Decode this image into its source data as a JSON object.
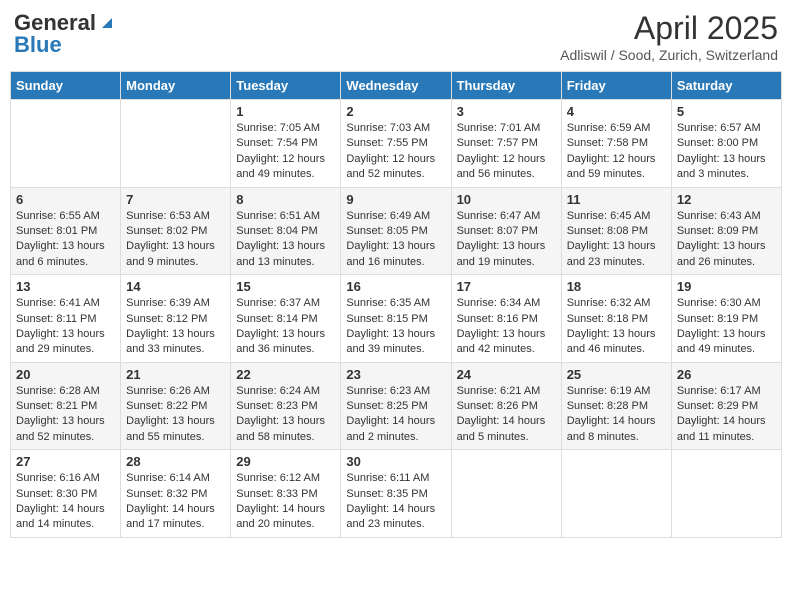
{
  "header": {
    "logo_general": "General",
    "logo_blue": "Blue",
    "title": "April 2025",
    "subtitle": "Adliswil / Sood, Zurich, Switzerland"
  },
  "days_of_week": [
    "Sunday",
    "Monday",
    "Tuesday",
    "Wednesday",
    "Thursday",
    "Friday",
    "Saturday"
  ],
  "weeks": [
    [
      {
        "day": "",
        "sunrise": "",
        "sunset": "",
        "daylight": ""
      },
      {
        "day": "",
        "sunrise": "",
        "sunset": "",
        "daylight": ""
      },
      {
        "day": "1",
        "sunrise": "Sunrise: 7:05 AM",
        "sunset": "Sunset: 7:54 PM",
        "daylight": "Daylight: 12 hours and 49 minutes."
      },
      {
        "day": "2",
        "sunrise": "Sunrise: 7:03 AM",
        "sunset": "Sunset: 7:55 PM",
        "daylight": "Daylight: 12 hours and 52 minutes."
      },
      {
        "day": "3",
        "sunrise": "Sunrise: 7:01 AM",
        "sunset": "Sunset: 7:57 PM",
        "daylight": "Daylight: 12 hours and 56 minutes."
      },
      {
        "day": "4",
        "sunrise": "Sunrise: 6:59 AM",
        "sunset": "Sunset: 7:58 PM",
        "daylight": "Daylight: 12 hours and 59 minutes."
      },
      {
        "day": "5",
        "sunrise": "Sunrise: 6:57 AM",
        "sunset": "Sunset: 8:00 PM",
        "daylight": "Daylight: 13 hours and 3 minutes."
      }
    ],
    [
      {
        "day": "6",
        "sunrise": "Sunrise: 6:55 AM",
        "sunset": "Sunset: 8:01 PM",
        "daylight": "Daylight: 13 hours and 6 minutes."
      },
      {
        "day": "7",
        "sunrise": "Sunrise: 6:53 AM",
        "sunset": "Sunset: 8:02 PM",
        "daylight": "Daylight: 13 hours and 9 minutes."
      },
      {
        "day": "8",
        "sunrise": "Sunrise: 6:51 AM",
        "sunset": "Sunset: 8:04 PM",
        "daylight": "Daylight: 13 hours and 13 minutes."
      },
      {
        "day": "9",
        "sunrise": "Sunrise: 6:49 AM",
        "sunset": "Sunset: 8:05 PM",
        "daylight": "Daylight: 13 hours and 16 minutes."
      },
      {
        "day": "10",
        "sunrise": "Sunrise: 6:47 AM",
        "sunset": "Sunset: 8:07 PM",
        "daylight": "Daylight: 13 hours and 19 minutes."
      },
      {
        "day": "11",
        "sunrise": "Sunrise: 6:45 AM",
        "sunset": "Sunset: 8:08 PM",
        "daylight": "Daylight: 13 hours and 23 minutes."
      },
      {
        "day": "12",
        "sunrise": "Sunrise: 6:43 AM",
        "sunset": "Sunset: 8:09 PM",
        "daylight": "Daylight: 13 hours and 26 minutes."
      }
    ],
    [
      {
        "day": "13",
        "sunrise": "Sunrise: 6:41 AM",
        "sunset": "Sunset: 8:11 PM",
        "daylight": "Daylight: 13 hours and 29 minutes."
      },
      {
        "day": "14",
        "sunrise": "Sunrise: 6:39 AM",
        "sunset": "Sunset: 8:12 PM",
        "daylight": "Daylight: 13 hours and 33 minutes."
      },
      {
        "day": "15",
        "sunrise": "Sunrise: 6:37 AM",
        "sunset": "Sunset: 8:14 PM",
        "daylight": "Daylight: 13 hours and 36 minutes."
      },
      {
        "day": "16",
        "sunrise": "Sunrise: 6:35 AM",
        "sunset": "Sunset: 8:15 PM",
        "daylight": "Daylight: 13 hours and 39 minutes."
      },
      {
        "day": "17",
        "sunrise": "Sunrise: 6:34 AM",
        "sunset": "Sunset: 8:16 PM",
        "daylight": "Daylight: 13 hours and 42 minutes."
      },
      {
        "day": "18",
        "sunrise": "Sunrise: 6:32 AM",
        "sunset": "Sunset: 8:18 PM",
        "daylight": "Daylight: 13 hours and 46 minutes."
      },
      {
        "day": "19",
        "sunrise": "Sunrise: 6:30 AM",
        "sunset": "Sunset: 8:19 PM",
        "daylight": "Daylight: 13 hours and 49 minutes."
      }
    ],
    [
      {
        "day": "20",
        "sunrise": "Sunrise: 6:28 AM",
        "sunset": "Sunset: 8:21 PM",
        "daylight": "Daylight: 13 hours and 52 minutes."
      },
      {
        "day": "21",
        "sunrise": "Sunrise: 6:26 AM",
        "sunset": "Sunset: 8:22 PM",
        "daylight": "Daylight: 13 hours and 55 minutes."
      },
      {
        "day": "22",
        "sunrise": "Sunrise: 6:24 AM",
        "sunset": "Sunset: 8:23 PM",
        "daylight": "Daylight: 13 hours and 58 minutes."
      },
      {
        "day": "23",
        "sunrise": "Sunrise: 6:23 AM",
        "sunset": "Sunset: 8:25 PM",
        "daylight": "Daylight: 14 hours and 2 minutes."
      },
      {
        "day": "24",
        "sunrise": "Sunrise: 6:21 AM",
        "sunset": "Sunset: 8:26 PM",
        "daylight": "Daylight: 14 hours and 5 minutes."
      },
      {
        "day": "25",
        "sunrise": "Sunrise: 6:19 AM",
        "sunset": "Sunset: 8:28 PM",
        "daylight": "Daylight: 14 hours and 8 minutes."
      },
      {
        "day": "26",
        "sunrise": "Sunrise: 6:17 AM",
        "sunset": "Sunset: 8:29 PM",
        "daylight": "Daylight: 14 hours and 11 minutes."
      }
    ],
    [
      {
        "day": "27",
        "sunrise": "Sunrise: 6:16 AM",
        "sunset": "Sunset: 8:30 PM",
        "daylight": "Daylight: 14 hours and 14 minutes."
      },
      {
        "day": "28",
        "sunrise": "Sunrise: 6:14 AM",
        "sunset": "Sunset: 8:32 PM",
        "daylight": "Daylight: 14 hours and 17 minutes."
      },
      {
        "day": "29",
        "sunrise": "Sunrise: 6:12 AM",
        "sunset": "Sunset: 8:33 PM",
        "daylight": "Daylight: 14 hours and 20 minutes."
      },
      {
        "day": "30",
        "sunrise": "Sunrise: 6:11 AM",
        "sunset": "Sunset: 8:35 PM",
        "daylight": "Daylight: 14 hours and 23 minutes."
      },
      {
        "day": "",
        "sunrise": "",
        "sunset": "",
        "daylight": ""
      },
      {
        "day": "",
        "sunrise": "",
        "sunset": "",
        "daylight": ""
      },
      {
        "day": "",
        "sunrise": "",
        "sunset": "",
        "daylight": ""
      }
    ]
  ]
}
